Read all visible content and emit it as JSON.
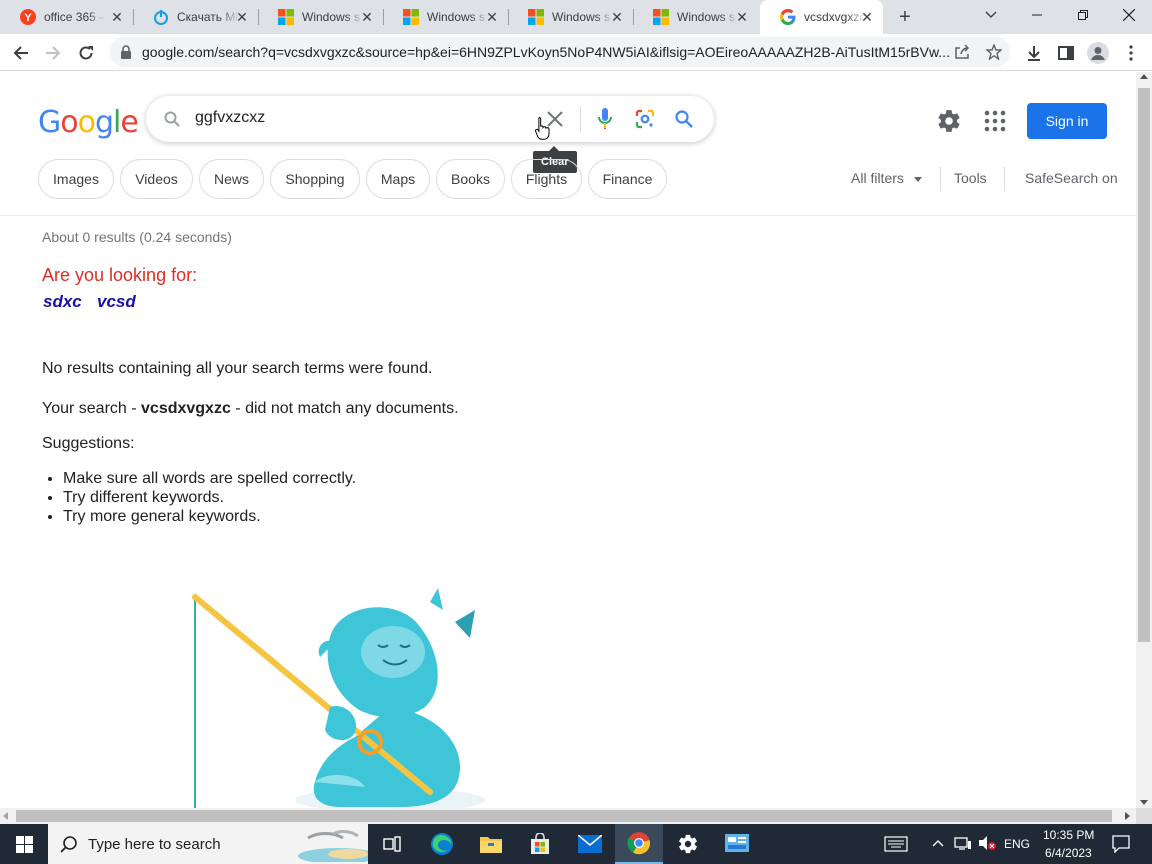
{
  "tabs": [
    {
      "title": "office 365 – "
    },
    {
      "title": "Скачать Mi"
    },
    {
      "title": "Windows s"
    },
    {
      "title": "Windows s"
    },
    {
      "title": "Windows s"
    },
    {
      "title": "Windows s"
    },
    {
      "title": "vcsdxvgxzc"
    }
  ],
  "browser": {
    "url": "google.com/search?q=vcsdxvgxzc&source=hp&ei=6HN9ZPLvKoyn5NoP4NW5iAI&iflsig=AOEireoAAAAAZH2B-AiTusItM15rBVw..."
  },
  "google": {
    "logo_text": "Google",
    "query": "ggfvxzcxz",
    "tooltip": "Clear",
    "sign_in": "Sign in",
    "chips": [
      "Images",
      "Videos",
      "News",
      "Shopping",
      "Maps",
      "Books",
      "Flights",
      "Finance"
    ],
    "all_filters": "All filters",
    "tools": "Tools",
    "safesearch": "SafeSearch on"
  },
  "results": {
    "stats": "About 0 results (0.24 seconds)",
    "looking_for": "Are you looking for:",
    "suggestions": [
      "sdxc",
      "vcsd"
    ],
    "no_results": "No results containing all your search terms were found.",
    "your_search_prefix": "Your search - ",
    "your_search_term": "vcsdxvgxzc",
    "your_search_suffix": " - did not match any documents.",
    "suggestions_label": "Suggestions:",
    "tips": [
      "Make sure all words are spelled correctly.",
      "Try different keywords.",
      "Try more general keywords."
    ]
  },
  "taskbar": {
    "search_placeholder": "Type here to search",
    "lang": "ENG",
    "time": "10:35 PM",
    "date": "6/4/2023"
  },
  "colors": {
    "google_blue": "#4285f4",
    "google_red": "#ea4335",
    "google_yellow": "#fbbc05",
    "google_green": "#34a853",
    "link": "#1a0dab",
    "signin": "#1a73e8"
  }
}
